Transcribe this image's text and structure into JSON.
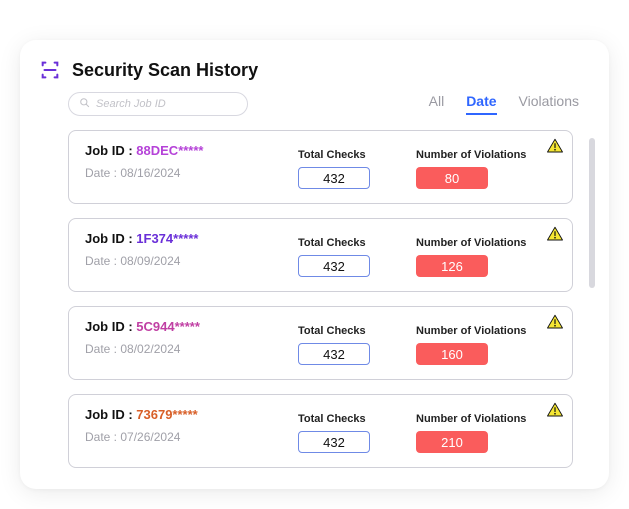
{
  "header": {
    "title": "Security Scan History"
  },
  "search": {
    "placeholder": "Search Job ID"
  },
  "tabs": {
    "all": "All",
    "date": "Date",
    "violations": "Violations"
  },
  "labels": {
    "jobid_prefix": "Job ID : ",
    "date_prefix": "Date : ",
    "total_checks": "Total Checks",
    "num_violations": "Number of Violations"
  },
  "scans": [
    {
      "jobid": "88DEC*****",
      "date": "08/16/2024",
      "checks": "432",
      "violations": "80"
    },
    {
      "jobid": "1F374*****",
      "date": "08/09/2024",
      "checks": "432",
      "violations": "126"
    },
    {
      "jobid": "5C944*****",
      "date": "08/02/2024",
      "checks": "432",
      "violations": "160"
    },
    {
      "jobid": "73679*****",
      "date": "07/26/2024",
      "checks": "432",
      "violations": "210"
    }
  ]
}
